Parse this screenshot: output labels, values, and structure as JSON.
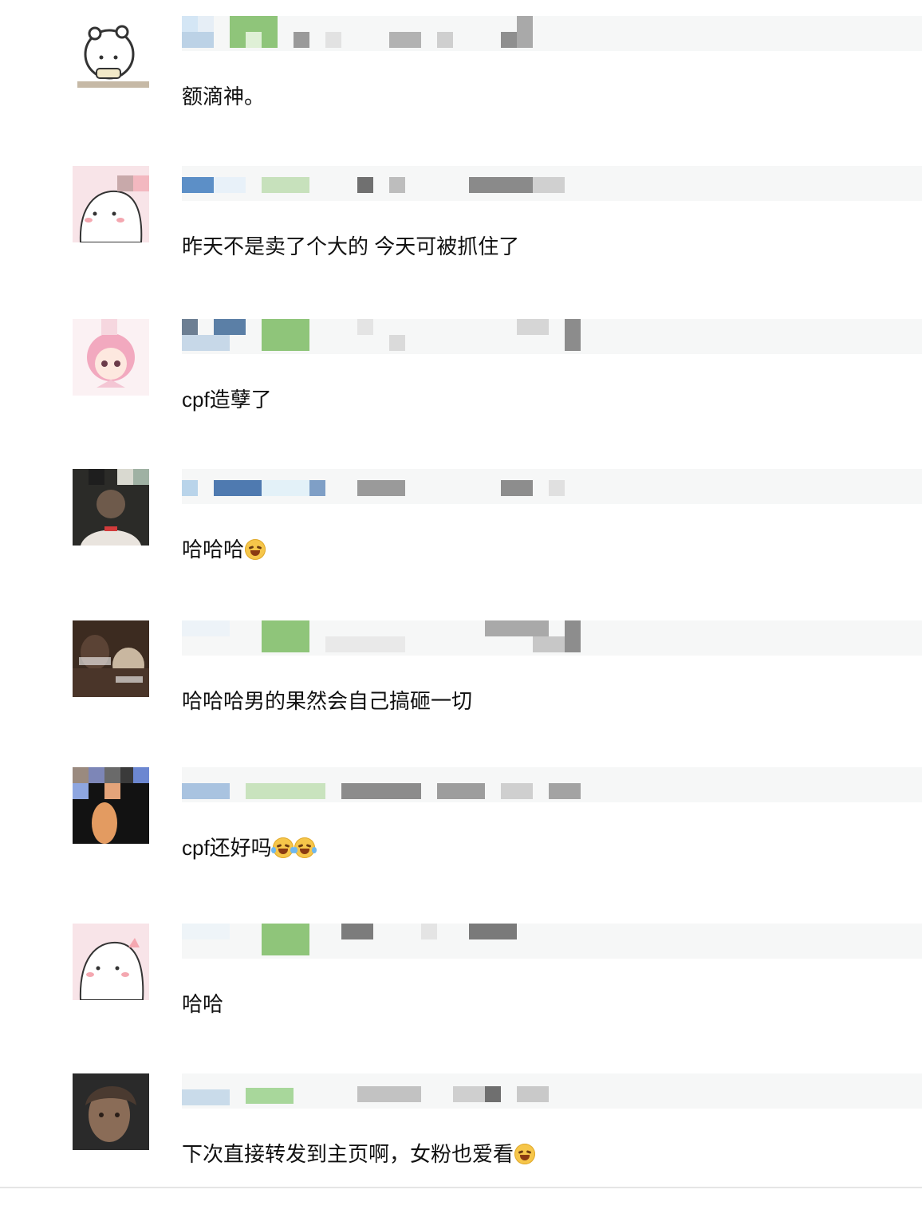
{
  "comments": [
    {
      "text": "额滴神。",
      "emoji": [],
      "avatar_icon": "bear-sticker-avatar-icon"
    },
    {
      "text": "昨天不是卖了个大的 今天可被抓住了",
      "emoji": [],
      "avatar_icon": "pink-cartoon-avatar-icon"
    },
    {
      "text": "cpf造孽了",
      "emoji": [],
      "avatar_icon": "pink-doll-avatar-icon"
    },
    {
      "text": "哈哈哈",
      "emoji": [
        "rofl"
      ],
      "avatar_icon": "photo-avatar-icon"
    },
    {
      "text": "哈哈哈男的果然会自己搞砸一切",
      "emoji": [],
      "avatar_icon": "dog-meme-avatar-icon"
    },
    {
      "text": "cpf还好吗",
      "emoji": [
        "tears-of-joy",
        "tears-of-joy"
      ],
      "avatar_icon": "night-photo-avatar-icon"
    },
    {
      "text": "哈哈",
      "emoji": [],
      "avatar_icon": "pink-cartoon-avatar-icon"
    },
    {
      "text": "下次直接转发到主页啊，女粉也爱看",
      "emoji": [
        "rofl"
      ],
      "avatar_icon": "portrait-avatar-icon"
    }
  ],
  "colors": {
    "text": "#111111",
    "meta_background": "#f6f7f7",
    "emoji_face": "#f6c64a"
  }
}
